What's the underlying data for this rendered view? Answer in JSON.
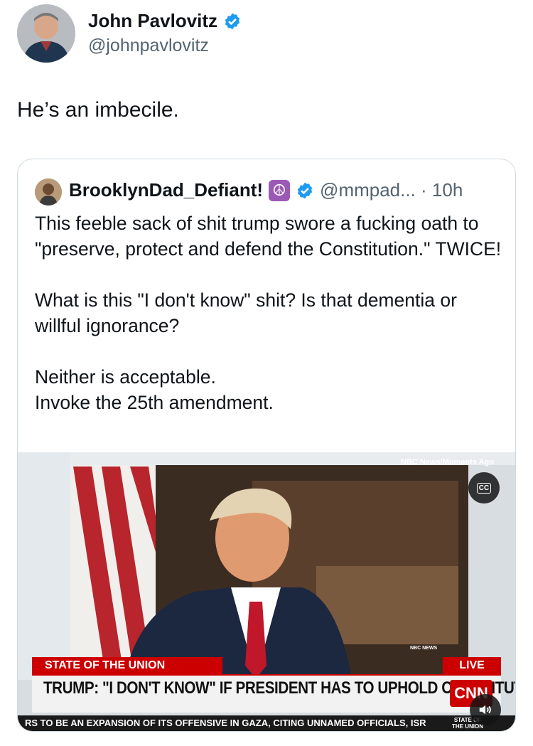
{
  "author": {
    "name": "John Pavlovitz",
    "handle": "@johnpavlovitz",
    "verified_color": "#1d9bf0"
  },
  "tweet": {
    "text": "He’s an imbecile."
  },
  "quoted": {
    "name": "BrooklynDad_Defiant!",
    "badge_icon": "peace-sign-icon",
    "handle_time": "@mmpad... · 10h",
    "paragraphs": [
      "This feeble sack of shit trump swore a fucking oath to \"preserve, protect and defend the Constitution.\" TWICE!",
      "What is this \"I don't know\" shit? Is that dementia or willful ignorance?",
      "Neither is acceptable.\nInvoke the 25th amendment."
    ],
    "video": {
      "source_tag": "NBC News/Moments Ago",
      "cc_label": "CC",
      "segment_label": "STATE OF THE UNION",
      "live_label": "LIVE",
      "network_small": "NBC NEWS",
      "headline": "TRUMP: \"I DON'T KNOW\" IF PRESIDENT HAS TO UPHOLD CONSTITUTION",
      "network_logo": "CNN",
      "ticker": "RS TO BE AN EXPANSION OF ITS OFFENSIVE IN GAZA, CITING UNNAMED OFFICIALS, ISR",
      "ticker_logo": "STATE OF THE UNION"
    }
  }
}
